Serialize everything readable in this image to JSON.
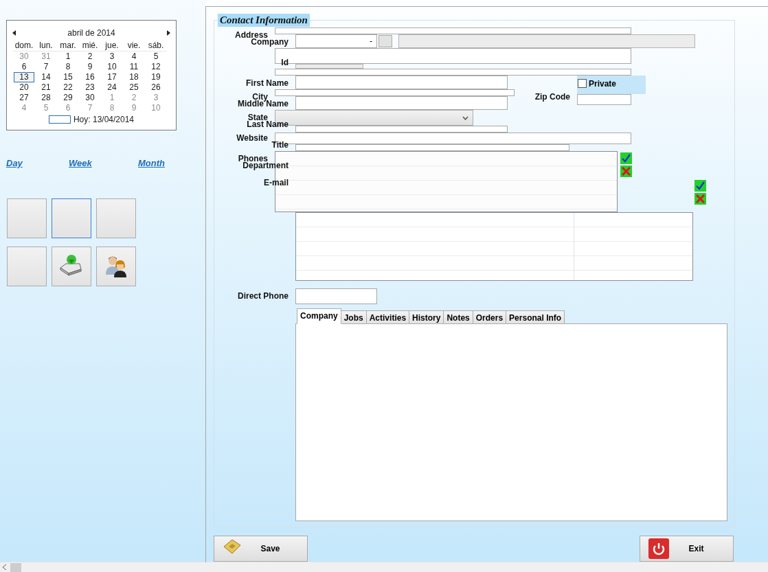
{
  "calendar": {
    "month_label": "abril de 2014",
    "weekdays": [
      "dom.",
      "lun.",
      "mar.",
      "mié.",
      "jue.",
      "vie.",
      "sáb."
    ],
    "weeks": [
      [
        {
          "day": "30",
          "other_month": true,
          "selected": false
        },
        {
          "day": "31",
          "other_month": true,
          "selected": false
        },
        {
          "day": "1",
          "other_month": false,
          "selected": false
        },
        {
          "day": "2",
          "other_month": false,
          "selected": false
        },
        {
          "day": "3",
          "other_month": false,
          "selected": false
        },
        {
          "day": "4",
          "other_month": false,
          "selected": false
        },
        {
          "day": "5",
          "other_month": false,
          "selected": false
        }
      ],
      [
        {
          "day": "6",
          "other_month": false,
          "selected": false
        },
        {
          "day": "7",
          "other_month": false,
          "selected": false
        },
        {
          "day": "8",
          "other_month": false,
          "selected": false
        },
        {
          "day": "9",
          "other_month": false,
          "selected": false
        },
        {
          "day": "10",
          "other_month": false,
          "selected": false
        },
        {
          "day": "11",
          "other_month": false,
          "selected": false
        },
        {
          "day": "12",
          "other_month": false,
          "selected": false
        }
      ],
      [
        {
          "day": "13",
          "other_month": false,
          "selected": true
        },
        {
          "day": "14",
          "other_month": false,
          "selected": false
        },
        {
          "day": "15",
          "other_month": false,
          "selected": false
        },
        {
          "day": "16",
          "other_month": false,
          "selected": false
        },
        {
          "day": "17",
          "other_month": false,
          "selected": false
        },
        {
          "day": "18",
          "other_month": false,
          "selected": false
        },
        {
          "day": "19",
          "other_month": false,
          "selected": false
        }
      ],
      [
        {
          "day": "20",
          "other_month": false,
          "selected": false
        },
        {
          "day": "21",
          "other_month": false,
          "selected": false
        },
        {
          "day": "22",
          "other_month": false,
          "selected": false
        },
        {
          "day": "23",
          "other_month": false,
          "selected": false
        },
        {
          "day": "24",
          "other_month": false,
          "selected": false
        },
        {
          "day": "25",
          "other_month": false,
          "selected": false
        },
        {
          "day": "26",
          "other_month": false,
          "selected": false
        }
      ],
      [
        {
          "day": "27",
          "other_month": false,
          "selected": false
        },
        {
          "day": "28",
          "other_month": false,
          "selected": false
        },
        {
          "day": "29",
          "other_month": false,
          "selected": false
        },
        {
          "day": "30",
          "other_month": false,
          "selected": false
        },
        {
          "day": "1",
          "other_month": true,
          "selected": false
        },
        {
          "day": "2",
          "other_month": true,
          "selected": false
        },
        {
          "day": "3",
          "other_month": true,
          "selected": false
        }
      ],
      [
        {
          "day": "4",
          "other_month": true,
          "selected": false
        },
        {
          "day": "5",
          "other_month": true,
          "selected": false
        },
        {
          "day": "6",
          "other_month": true,
          "selected": false
        },
        {
          "day": "7",
          "other_month": true,
          "selected": false
        },
        {
          "day": "8",
          "other_month": true,
          "selected": false
        },
        {
          "day": "9",
          "other_month": true,
          "selected": false
        },
        {
          "day": "10",
          "other_month": true,
          "selected": false
        }
      ]
    ],
    "today_label": "Hoy: 13/04/2014"
  },
  "view_links": [
    {
      "label": "Day"
    },
    {
      "label": "Week"
    },
    {
      "label": "Month"
    }
  ],
  "tiles": [
    {
      "kind": "blank",
      "focused": false
    },
    {
      "kind": "blank",
      "focused": true
    },
    {
      "kind": "blank",
      "focused": false
    },
    {
      "kind": "blank",
      "focused": false
    },
    {
      "kind": "drive",
      "focused": false
    },
    {
      "kind": "people",
      "focused": false
    }
  ],
  "form": {
    "title": "Contact Information",
    "labels": [
      "Address",
      "Company",
      "Id",
      "First Name",
      "City",
      "Middle Name",
      "Zip Code",
      "State",
      "Last Name",
      "Website",
      "Title",
      "Phones",
      "Department",
      "E-mail",
      "Direct Phone"
    ],
    "company_combo": {
      "value": "-"
    },
    "private": {
      "label": "Private",
      "checked": false
    },
    "tabs": [
      {
        "label": "Company",
        "selected": true
      },
      {
        "label": "Jobs",
        "selected": false
      },
      {
        "label": "Activities",
        "selected": false
      },
      {
        "label": "History",
        "selected": false
      },
      {
        "label": "Notes",
        "selected": false
      },
      {
        "label": "Orders",
        "selected": false
      },
      {
        "label": "Personal Info",
        "selected": false
      }
    ]
  },
  "buttons": [
    {
      "kind": "save",
      "label": "Save"
    },
    {
      "kind": "exit",
      "label": "Exit"
    }
  ]
}
